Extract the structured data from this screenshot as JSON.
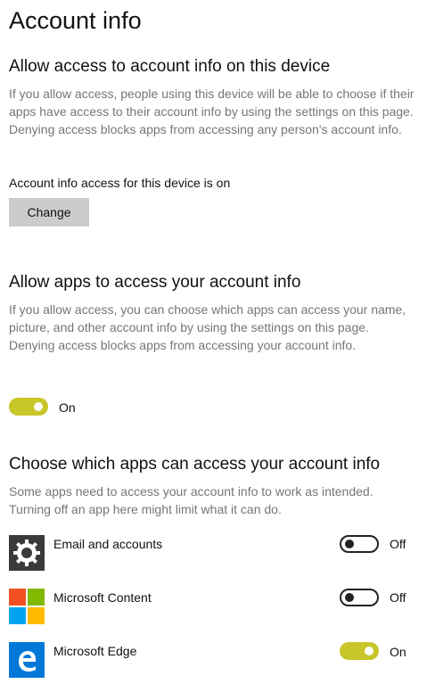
{
  "page": {
    "title": "Account info"
  },
  "device_section": {
    "title": "Allow access to account info on this device",
    "description": "If you allow access, people using this device will be able to choose if their apps have access to their account info by using the settings on this page. Denying access blocks apps from accessing any person's account info.",
    "status": "Account info access for this device is on",
    "change_label": "Change"
  },
  "apps_section": {
    "title": "Allow apps to access your account info",
    "description": "If you allow access, you can choose which apps can access your name, picture, and other account info by using the settings on this page. Denying access blocks apps from accessing your account info.",
    "toggle_state": "On"
  },
  "choose_section": {
    "title": "Choose which apps can access your account info",
    "description": "Some apps need to access your account info to work as intended. Turning off an app here might limit what it can do.",
    "apps": [
      {
        "name": "Email and accounts",
        "state": "Off",
        "icon": "gear-icon"
      },
      {
        "name": "Microsoft Content",
        "state": "Off",
        "icon": "microsoft-logo-icon"
      },
      {
        "name": "Microsoft Edge",
        "state": "On",
        "icon": "edge-icon"
      }
    ]
  },
  "colors": {
    "toggle_on": "#c8c628",
    "edge_blue": "#0078d7"
  }
}
